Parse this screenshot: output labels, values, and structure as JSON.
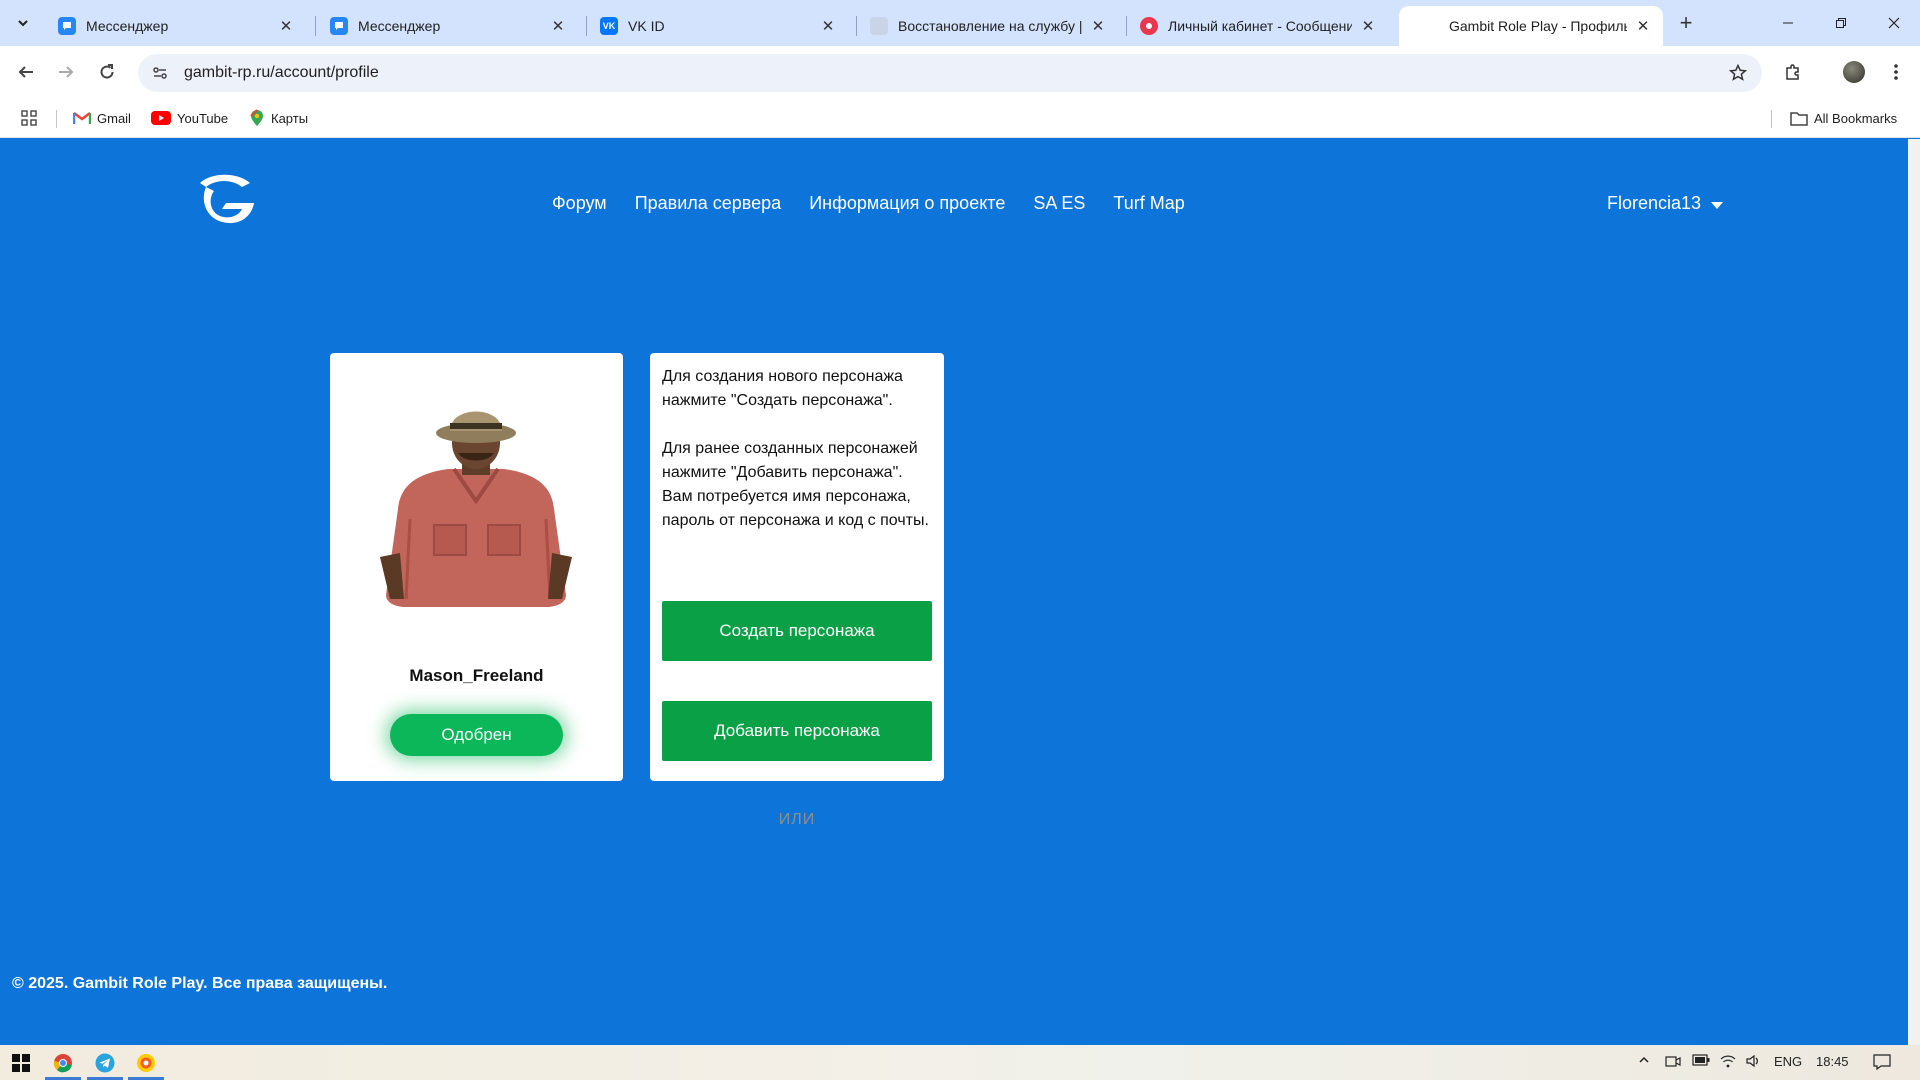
{
  "browser": {
    "tabs": [
      {
        "title": "Мессенджер",
        "icon": "messenger-icon",
        "active": false
      },
      {
        "title": "Мессенджер",
        "icon": "messenger-icon",
        "active": false
      },
      {
        "title": "VK ID",
        "icon": "vk-icon",
        "active": false
      },
      {
        "title": "Восстановление на службу | S",
        "icon": "site-icon",
        "active": false
      },
      {
        "title": "Личный кабинет - Сообщени",
        "icon": "record-icon",
        "active": false
      },
      {
        "title": "Gambit Role Play - Профиль U",
        "icon": "none",
        "active": true
      }
    ],
    "url": "gambit-rp.ru/account/profile",
    "bookmarks": [
      {
        "label": "Gmail",
        "icon": "gmail-icon"
      },
      {
        "label": "YouTube",
        "icon": "youtube-icon"
      },
      {
        "label": "Карты",
        "icon": "maps-icon"
      }
    ],
    "all_bookmarks": "All Bookmarks"
  },
  "site": {
    "nav": [
      "Форум",
      "Правила сервера",
      "Информация о проекте",
      "SA ES",
      "Turf Map"
    ],
    "username": "Florencia13",
    "character": {
      "name": "Mason_Freeland",
      "status": "Одобрен"
    },
    "info": {
      "paragraph1": "Для создания нового персонажа нажмите \"Создать персонажа\".",
      "paragraph2": "Для ранее созданных персонажей нажмите \"Добавить персонажа\". Вам потребуется имя персонажа, пароль от персонажа и код с почты.",
      "create_button": "Создать персонажа",
      "or_label": "ИЛИ",
      "add_button": "Добавить персонажа"
    },
    "footer": "© 2025. Gambit Role Play. Все права защищены."
  },
  "taskbar": {
    "language": "ENG",
    "time": "18:45"
  },
  "colors": {
    "page_bg": "#0d74d9",
    "green_button": "#0aa046",
    "status_button": "#0cb75a"
  }
}
